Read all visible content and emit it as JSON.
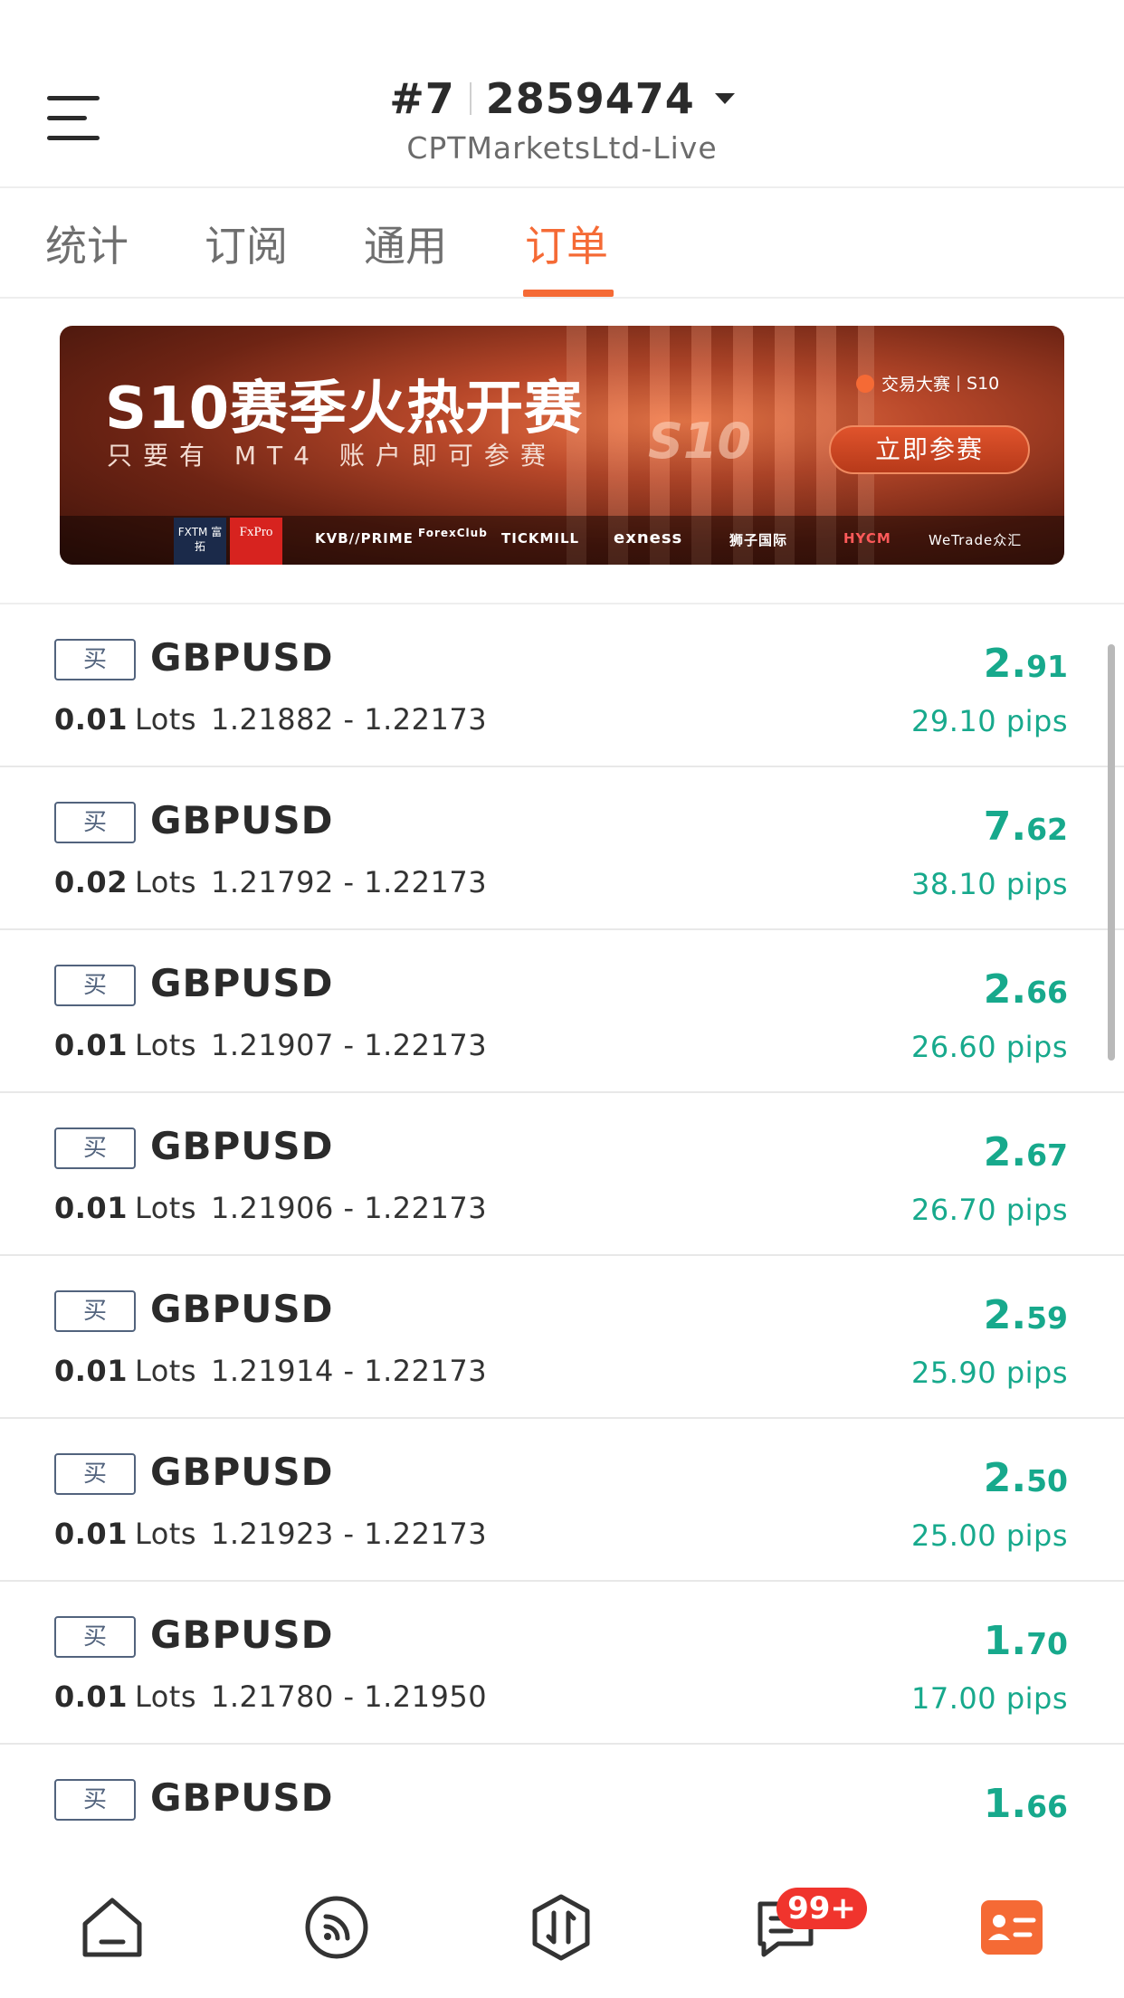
{
  "header": {
    "account_rank": "#7",
    "account_number": "2859474",
    "server": "CPTMarketsLtd-Live"
  },
  "tabs": [
    {
      "label": "统计",
      "active": false
    },
    {
      "label": "订阅",
      "active": false
    },
    {
      "label": "通用",
      "active": false
    },
    {
      "label": "订单",
      "active": true
    }
  ],
  "colors": {
    "accent": "#f56a35",
    "profit": "#17a98c",
    "badge": "#f0342d",
    "text": "#2b2b2b"
  },
  "banner": {
    "title": "S10赛季火热开赛",
    "subtitle": "只要有 MT4 账户即可参赛",
    "s10_mark": "S10",
    "tag_text": "交易大赛",
    "tag_season": "S10",
    "cta": "立即参赛",
    "brands": {
      "fxtm": "FXTM 富拓",
      "fxpro": "FxPro",
      "kvb": "KVB//PRIME",
      "forexclub": "ForexClub",
      "tickmill": "TICKMILL",
      "exness": "exness",
      "lion": "狮子国际",
      "hycm": "HYCM",
      "wetrade": "WeTrade众汇"
    }
  },
  "orders": [
    {
      "side": "买",
      "symbol": "GBPUSD",
      "lots": "0.01",
      "lots_unit": "Lots",
      "price_range": "1.21882 - 1.22173",
      "profit_int": "2.",
      "profit_dec": "91",
      "pips": "29.10 pips"
    },
    {
      "side": "买",
      "symbol": "GBPUSD",
      "lots": "0.02",
      "lots_unit": "Lots",
      "price_range": "1.21792 - 1.22173",
      "profit_int": "7.",
      "profit_dec": "62",
      "pips": "38.10 pips"
    },
    {
      "side": "买",
      "symbol": "GBPUSD",
      "lots": "0.01",
      "lots_unit": "Lots",
      "price_range": "1.21907 - 1.22173",
      "profit_int": "2.",
      "profit_dec": "66",
      "pips": "26.60 pips"
    },
    {
      "side": "买",
      "symbol": "GBPUSD",
      "lots": "0.01",
      "lots_unit": "Lots",
      "price_range": "1.21906 - 1.22173",
      "profit_int": "2.",
      "profit_dec": "67",
      "pips": "26.70 pips"
    },
    {
      "side": "买",
      "symbol": "GBPUSD",
      "lots": "0.01",
      "lots_unit": "Lots",
      "price_range": "1.21914 - 1.22173",
      "profit_int": "2.",
      "profit_dec": "59",
      "pips": "25.90 pips"
    },
    {
      "side": "买",
      "symbol": "GBPUSD",
      "lots": "0.01",
      "lots_unit": "Lots",
      "price_range": "1.21923 - 1.22173",
      "profit_int": "2.",
      "profit_dec": "50",
      "pips": "25.00 pips"
    },
    {
      "side": "买",
      "symbol": "GBPUSD",
      "lots": "0.01",
      "lots_unit": "Lots",
      "price_range": "1.21780 - 1.21950",
      "profit_int": "1.",
      "profit_dec": "70",
      "pips": "17.00 pips"
    },
    {
      "side": "买",
      "symbol": "GBPUSD",
      "profit_int": "1.",
      "profit_dec": "66"
    }
  ],
  "bottom_nav": {
    "items": [
      "home-icon",
      "feed-icon",
      "trade-icon",
      "message-icon",
      "profile-card-icon"
    ],
    "message_badge": "99+"
  }
}
